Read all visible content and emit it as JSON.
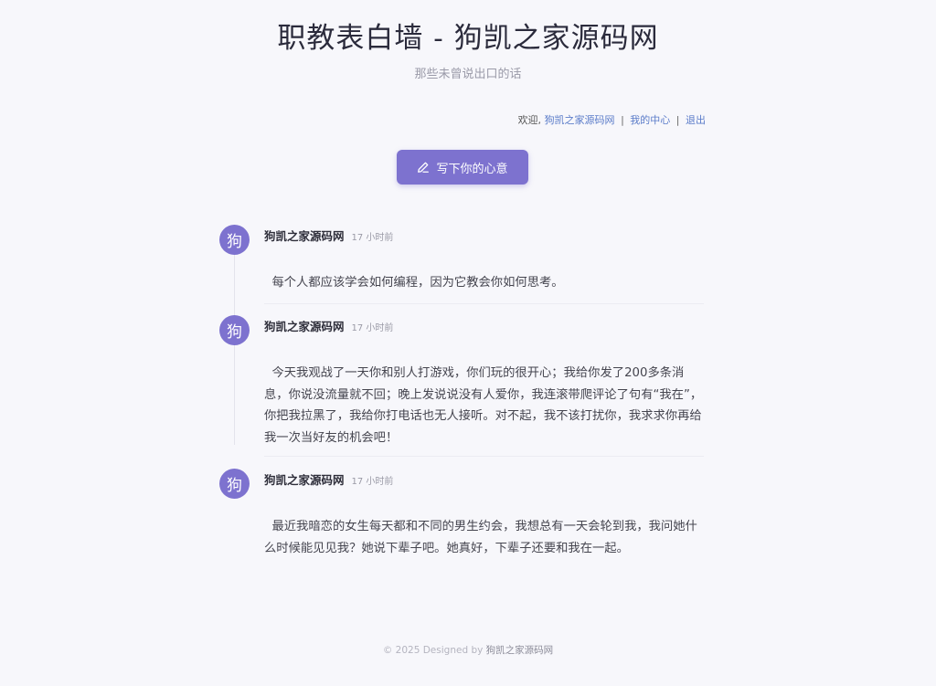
{
  "header": {
    "title": "职教表白墙 - 狗凯之家源码网",
    "subtitle": "那些未曾说出口的话"
  },
  "userbar": {
    "welcome": "欢迎,",
    "username": "狗凯之家源码网",
    "sep1": "|",
    "my_center": "我的中心",
    "sep2": "|",
    "logout": "退出"
  },
  "write_button": {
    "label": "写下你的心意",
    "icon": "pencil-icon"
  },
  "posts": [
    {
      "avatar": "狗",
      "author": "狗凯之家源码网",
      "time": "17 小时前",
      "content": "每个人都应该学会如何编程，因为它教会你如何思考。"
    },
    {
      "avatar": "狗",
      "author": "狗凯之家源码网",
      "time": "17 小时前",
      "content": "今天我观战了一天你和别人打游戏，你们玩的很开心；我给你发了200多条消息，你说没流量就不回；晚上发说说没有人爱你，我连滚带爬评论了句有“我在”，你把我拉黑了，我给你打电话也无人接听。对不起，我不该打扰你，我求求你再给我一次当好友的机会吧！"
    },
    {
      "avatar": "狗",
      "author": "狗凯之家源码网",
      "time": "17 小时前",
      "content": "最近我暗恋的女生每天都和不同的男生约会，我想总有一天会轮到我，我问她什么时候能见见我？她说下辈子吧。她真好，下辈子还要和我在一起。"
    }
  ],
  "footer": {
    "text": "© 2025 Designed by",
    "brand": "狗凯之家源码网"
  },
  "colors": {
    "accent": "#7d72cf",
    "link": "#5b7cc9",
    "background": "#f7f7fb"
  }
}
